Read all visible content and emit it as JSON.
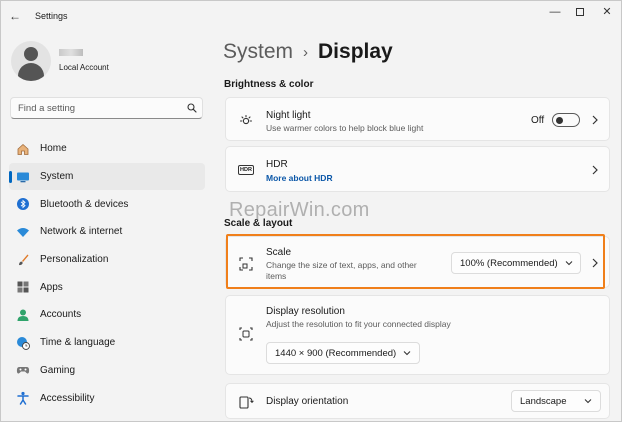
{
  "window": {
    "title": "Settings",
    "back_glyph": "←",
    "minimize_glyph": "—",
    "close_glyph": "✕"
  },
  "account": {
    "name": "",
    "type": "Local Account"
  },
  "search": {
    "placeholder": "Find a setting",
    "value": ""
  },
  "sidebar": {
    "items": [
      {
        "label": "Home",
        "icon": "home-icon",
        "active": false
      },
      {
        "label": "System",
        "icon": "monitor-icon",
        "active": true
      },
      {
        "label": "Bluetooth & devices",
        "icon": "bluetooth-icon",
        "active": false
      },
      {
        "label": "Network & internet",
        "icon": "wifi-icon",
        "active": false
      },
      {
        "label": "Personalization",
        "icon": "brush-icon",
        "active": false
      },
      {
        "label": "Apps",
        "icon": "apps-icon",
        "active": false
      },
      {
        "label": "Accounts",
        "icon": "person-icon",
        "active": false
      },
      {
        "label": "Time & language",
        "icon": "globe-clock-icon",
        "active": false
      },
      {
        "label": "Gaming",
        "icon": "gamepad-icon",
        "active": false
      },
      {
        "label": "Accessibility",
        "icon": "accessibility-icon",
        "active": false
      }
    ]
  },
  "breadcrumb": {
    "parent": "System",
    "separator": "›",
    "current": "Display"
  },
  "sections": {
    "brightness": "Brightness & color",
    "scale_layout": "Scale & layout"
  },
  "night_light": {
    "title": "Night light",
    "subtitle": "Use warmer colors to help block blue light",
    "state_label": "Off",
    "on": false
  },
  "hdr": {
    "icon_text": "HDR",
    "title": "HDR",
    "link": "More about HDR"
  },
  "scale": {
    "title": "Scale",
    "subtitle_line1": "Change the size of text, apps, and other",
    "subtitle_line2": "items",
    "value": "100% (Recommended)"
  },
  "resolution": {
    "title": "Display resolution",
    "subtitle": "Adjust the resolution to fit your connected display",
    "value": "1440 × 900 (Recommended)"
  },
  "orientation": {
    "title": "Display orientation",
    "value": "Landscape"
  },
  "watermark": "RepairWin.com",
  "colors": {
    "accent": "#0067c0",
    "highlight": "#f07f1a",
    "link": "#0b57a8"
  }
}
